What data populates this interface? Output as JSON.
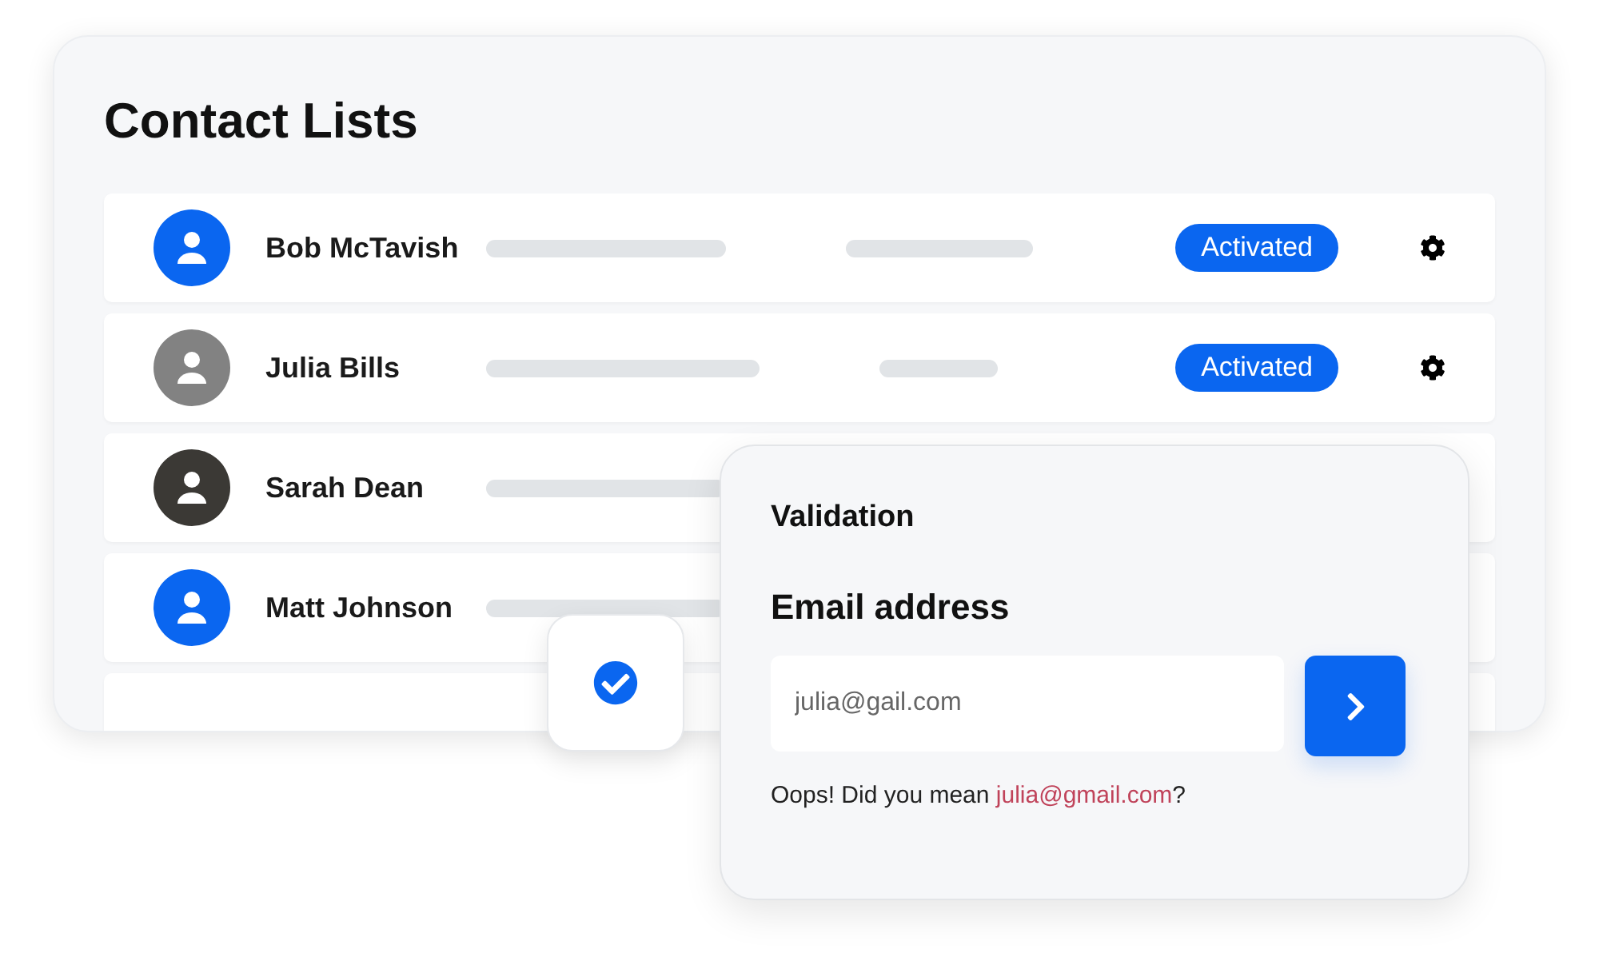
{
  "contact_lists": {
    "title": "Contact Lists",
    "rows": [
      {
        "name": "Bob McTavish",
        "color": "#0a66f0",
        "status": "Activated",
        "settings": true
      },
      {
        "name": "Julia Bills",
        "color": "#828282",
        "status": "Activated",
        "settings": true
      },
      {
        "name": "Sarah Dean",
        "color": "#3b3935"
      },
      {
        "name": "Matt Johnson",
        "color": "#0a66f0"
      }
    ]
  },
  "check_badge": {
    "checked": true
  },
  "validation": {
    "title": "Validation",
    "field_label": "Email address",
    "value": "julia@gail.com",
    "message": "Oops! Did you mean ",
    "suggestion": "julia@gmail.com",
    "message_end": "?"
  }
}
